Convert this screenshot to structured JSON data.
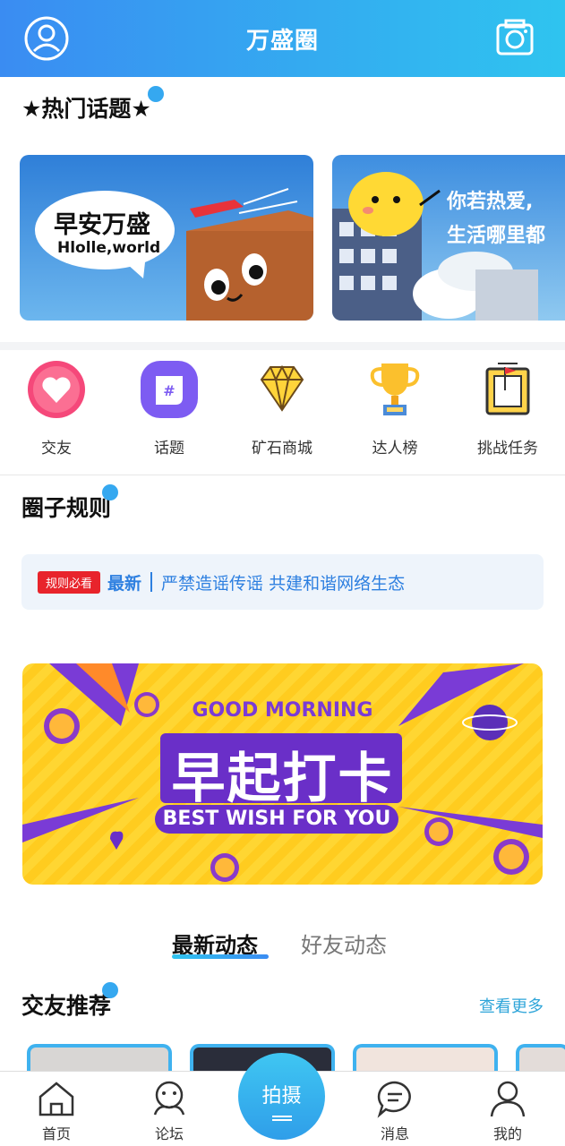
{
  "header": {
    "title": "万盛圈",
    "left_icon": "user-circle-icon",
    "right_icon": "camera-icon"
  },
  "hot_topics": {
    "title": "★热门话题★",
    "cards": [
      {
        "bubble_text": "早安万盛",
        "bubble_sub": "Hlolle,world"
      },
      {
        "caption_line1": "你若热爱,",
        "caption_line2": "生活哪里都"
      }
    ]
  },
  "menu": {
    "items": [
      {
        "label": "交友",
        "icon": "heart-icon"
      },
      {
        "label": "话题",
        "icon": "hashtag-icon"
      },
      {
        "label": "矿石商城",
        "icon": "diamond-icon"
      },
      {
        "label": "达人榜",
        "icon": "trophy-icon"
      },
      {
        "label": "挑战任务",
        "icon": "task-flag-icon"
      }
    ]
  },
  "rules": {
    "title": "圈子规则",
    "badge": "规则必看",
    "latest": "最新",
    "text": "严禁造谣传谣 共建和谐网络生态"
  },
  "banner": {
    "top_text": "GOOD MORNING",
    "main_text": "早起打卡",
    "bottom_text": "BEST WISH FOR YOU"
  },
  "feed_tabs": {
    "active": "最新动态",
    "inactive": "好友动态"
  },
  "friends": {
    "title": "交友推荐",
    "more": "查看更多"
  },
  "bottom_nav": {
    "items": [
      {
        "label": "首页",
        "icon": "home-icon"
      },
      {
        "label": "论坛",
        "icon": "forum-icon"
      },
      {
        "label": "消息",
        "icon": "message-icon"
      },
      {
        "label": "我的",
        "icon": "profile-icon"
      }
    ],
    "center": "拍摄"
  },
  "colors": {
    "header_start": "#3a8cf2",
    "header_end": "#2fc4ef",
    "accent": "#2d7fe0",
    "badge": "#e8242b",
    "banner_yellow": "#ffd632",
    "banner_purple": "#6a2fc8"
  }
}
